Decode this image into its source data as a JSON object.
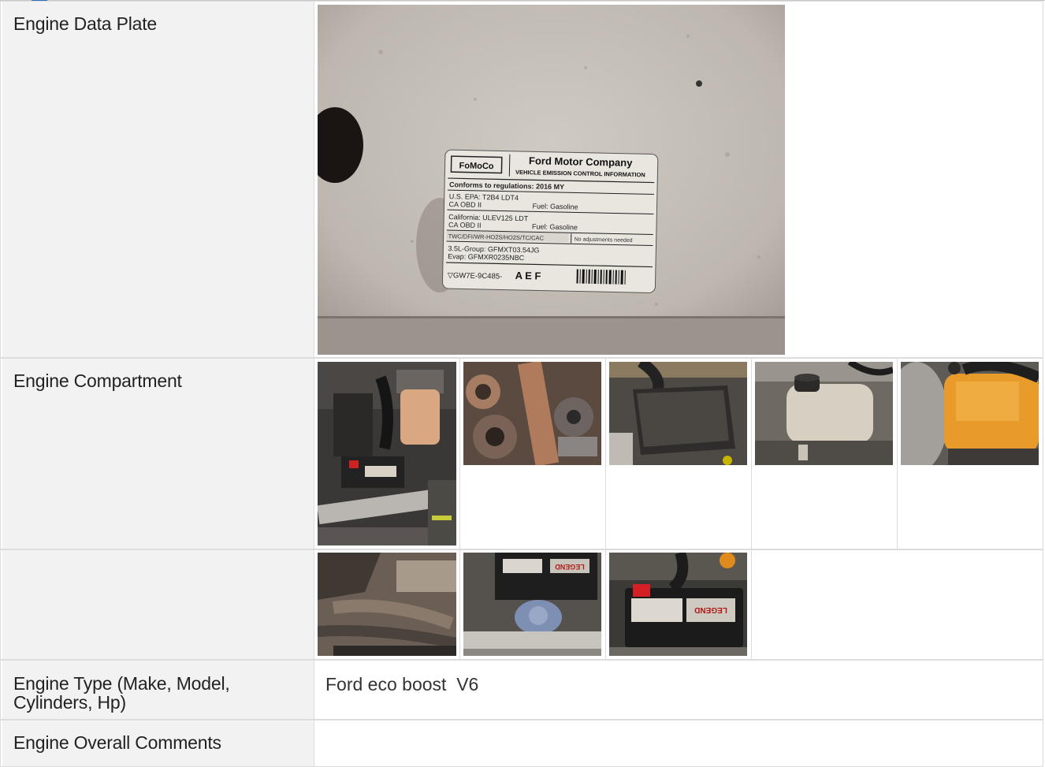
{
  "rows": [
    {
      "label": "Engine Data Plate"
    },
    {
      "label": "Engine Compartment"
    },
    {
      "label": ""
    },
    {
      "label": "Engine Type (Make, Model,\nCylinders, Hp)",
      "value": "Ford eco boost  V6"
    },
    {
      "label": "Engine Overall Comments",
      "value": ""
    }
  ],
  "data_plate": {
    "brand": "FoMoCo",
    "company": "Ford Motor Company",
    "subtitle": "VEHICLE EMISSION CONTROL INFORMATION",
    "conforms": "Conforms to regulations: 2016 MY",
    "epa": "U.S. EPA: T2B4 LDT4",
    "obd1": "CA OBD II",
    "fuel1": "Fuel: Gasoline",
    "california": "California: ULEV125 LDT",
    "obd2": "CA OBD II",
    "fuel2": "Fuel: Gasoline",
    "codes": "TWC/DFI/WR-HO2S/HO2S/TC/CAC",
    "adjust": "No adjustments needed",
    "group": "3.5L-Group: GFMXT03.54JG",
    "evap": "Evap: GFMXR0235NBC",
    "part": "▽GW7E-9C485-",
    "suffix": "A E F"
  },
  "photo_labels": {
    "battery_brand": "LEGEND"
  }
}
